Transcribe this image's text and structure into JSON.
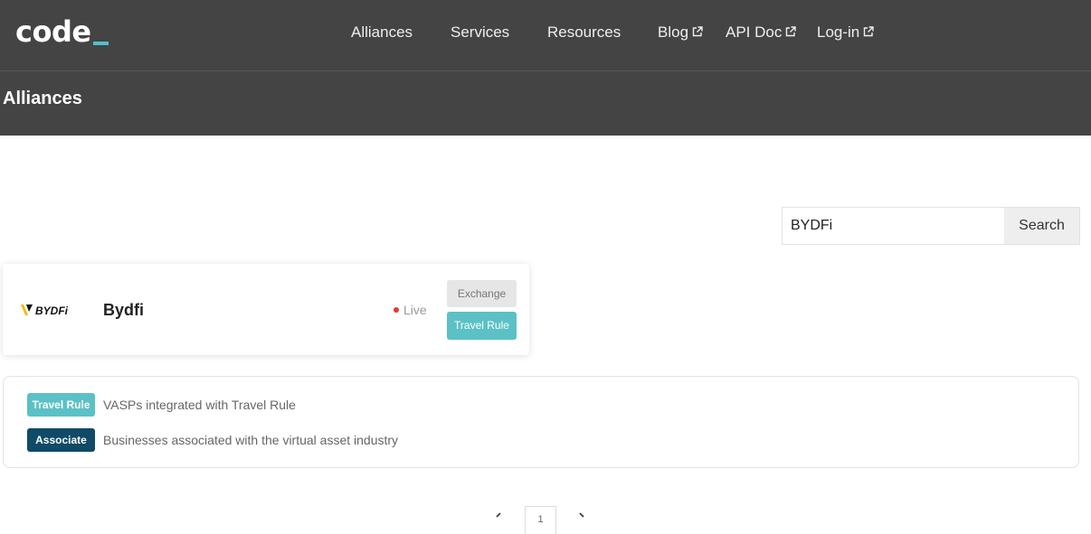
{
  "header": {
    "logo_text": "code",
    "nav": [
      {
        "label": "Alliances",
        "external": false
      },
      {
        "label": "Services",
        "external": false
      },
      {
        "label": "Resources",
        "external": false
      },
      {
        "label": "Blog",
        "external": true
      },
      {
        "label": "API Doc",
        "external": true
      },
      {
        "label": "Log-in",
        "external": true
      }
    ],
    "page_title": "Alliances"
  },
  "search": {
    "value": "BYDFi",
    "button_label": "Search"
  },
  "result": {
    "logo_text": "BYDFi",
    "name": "Bydfi",
    "status": "Live",
    "tags": [
      "Exchange",
      "Travel Rule"
    ]
  },
  "legend": [
    {
      "badge": "Travel Rule",
      "text": "VASPs integrated with Travel Rule"
    },
    {
      "badge": "Associate",
      "text": "Businesses associated with the virtual asset industry"
    }
  ],
  "pagination": {
    "current_page": "1"
  },
  "colors": {
    "header_bg": "#444444",
    "accent_teal": "#5bc1c6",
    "associate_navy": "#0f4a66",
    "live_red": "#e53935"
  }
}
